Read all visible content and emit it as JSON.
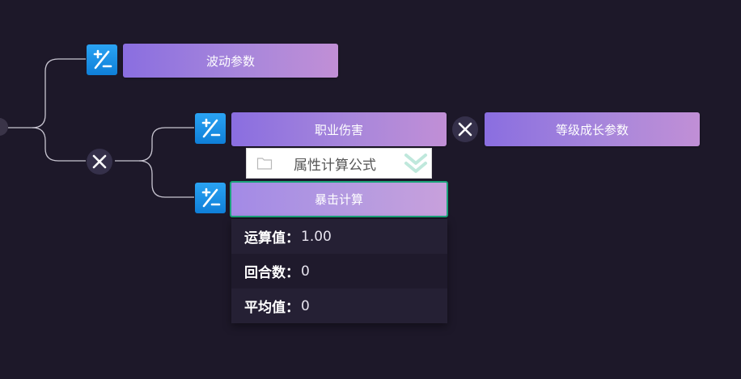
{
  "nodes": {
    "wave_params": "波动参数",
    "job_damage": "职业伤害",
    "level_growth": "等级成长参数",
    "crit_calc": "暴击计算"
  },
  "formula": {
    "label": "属性计算公式",
    "icon": "folder-icon",
    "collapse_icon": "double-chevron-down-icon"
  },
  "info": {
    "rows": [
      {
        "key": "运算值：",
        "value": "1.00"
      },
      {
        "key": "回合数：",
        "value": "0"
      },
      {
        "key": "平均值：",
        "value": "0"
      }
    ]
  },
  "colors": {
    "background": "#1d1829",
    "node_gradient_start": "#8a6ee0",
    "node_gradient_end": "#c18fd6",
    "op_icon_blue": "#1a8fe6",
    "selected_border": "#1aa37a",
    "connector": "#c9c6d2"
  }
}
